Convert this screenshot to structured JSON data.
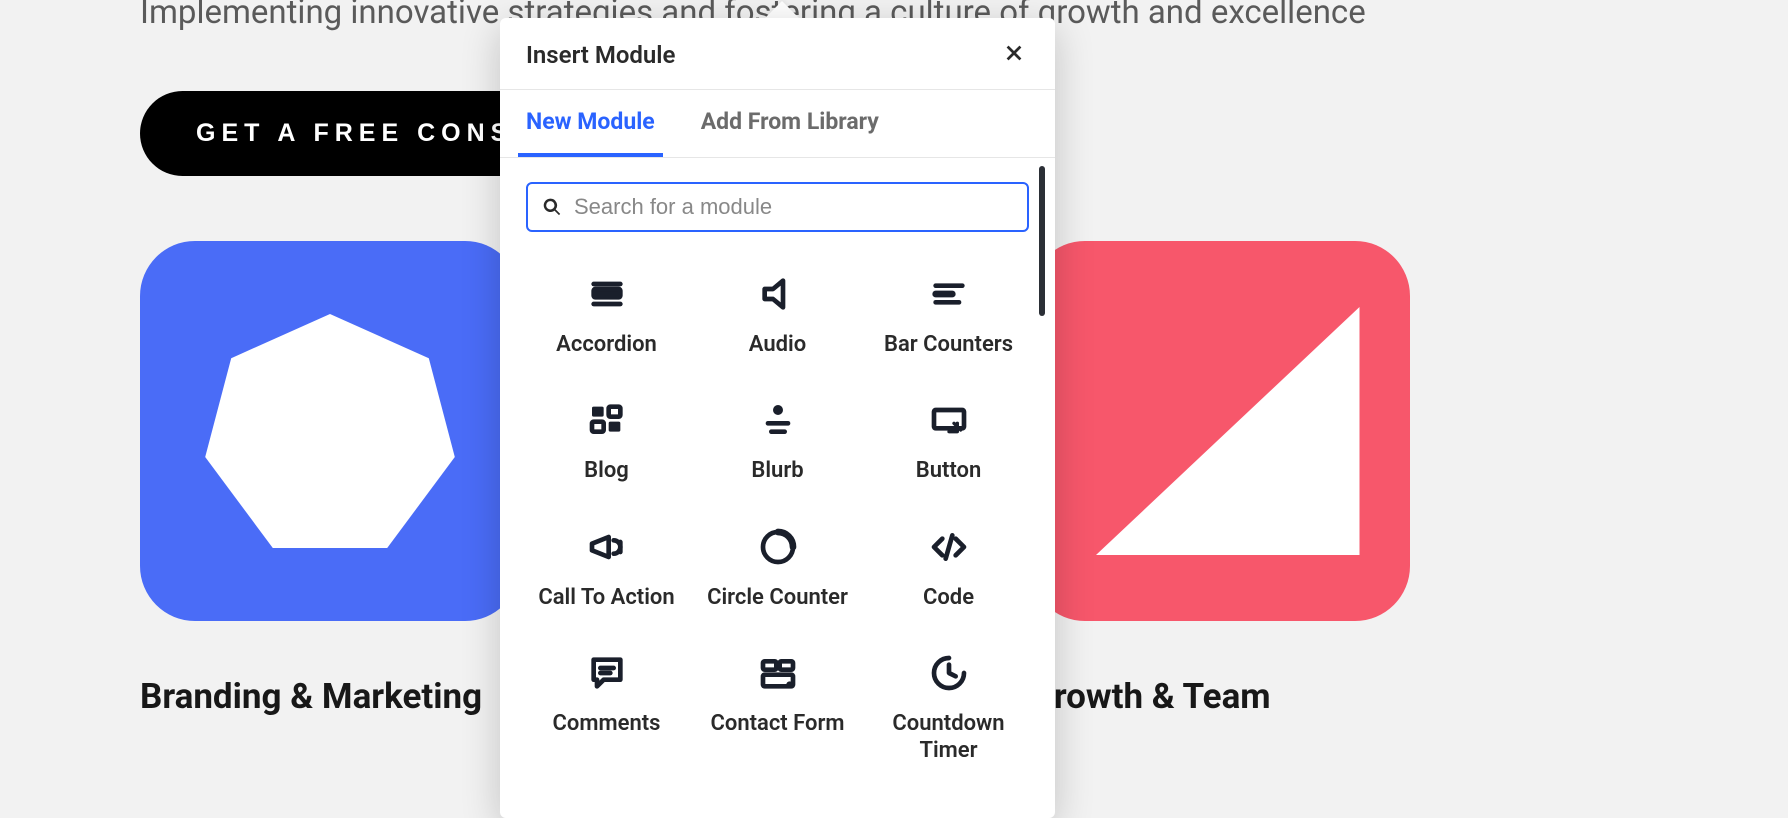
{
  "hero": {
    "subtitle": "Implementing innovative strategies and fostering a culture of growth and excellence",
    "cta_label": "GET A FREE CONSULTATION"
  },
  "cards": {
    "card0": {
      "title": "Branding & Marketing"
    },
    "card1": {
      "title": "Growth & Team"
    }
  },
  "modal": {
    "title": "Insert Module",
    "tabs": {
      "new_module": "New Module",
      "add_from_library": "Add From Library"
    },
    "search": {
      "placeholder": "Search for a module"
    },
    "modules": {
      "accordion": "Accordion",
      "audio": "Audio",
      "bar_counters": "Bar Counters",
      "blog": "Blog",
      "blurb": "Blurb",
      "button": "Button",
      "call_to_action": "Call To Action",
      "circle_counter": "Circle Counter",
      "code": "Code",
      "comments": "Comments",
      "contact": "Contact Form",
      "countdown": "Countdown Timer"
    }
  }
}
